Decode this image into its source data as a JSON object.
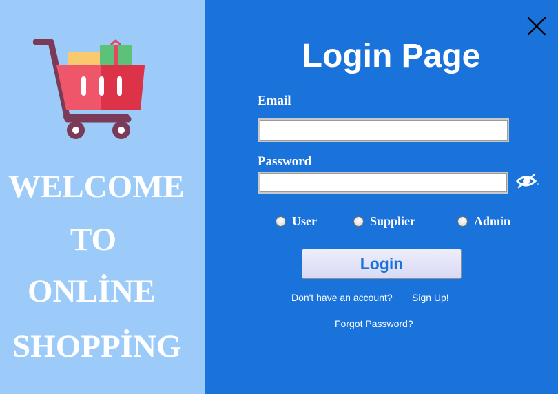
{
  "welcome": {
    "line1": "WELCOME",
    "line2": "TO",
    "line3": "ONLİNE",
    "line4": "SHOPPİNG"
  },
  "login": {
    "title": "Login Page",
    "email_label": "Email",
    "email_value": "",
    "password_label": "Password",
    "password_value": "",
    "roles": [
      "User",
      "Supplier",
      "Admin"
    ],
    "selected_role": null,
    "login_button": "Login",
    "no_account_text": "Don't have an account?",
    "signup_link": "Sign Up!",
    "forgot_password_link": "Forgot Password?"
  },
  "icons": {
    "close": "close-icon",
    "show_password": "eye-icon",
    "cart": "shopping-cart-icon"
  },
  "colors": {
    "left_panel": "#9ccbf9",
    "right_panel": "#1a73db",
    "text": "#ffffff",
    "button_text": "#1a73db"
  }
}
